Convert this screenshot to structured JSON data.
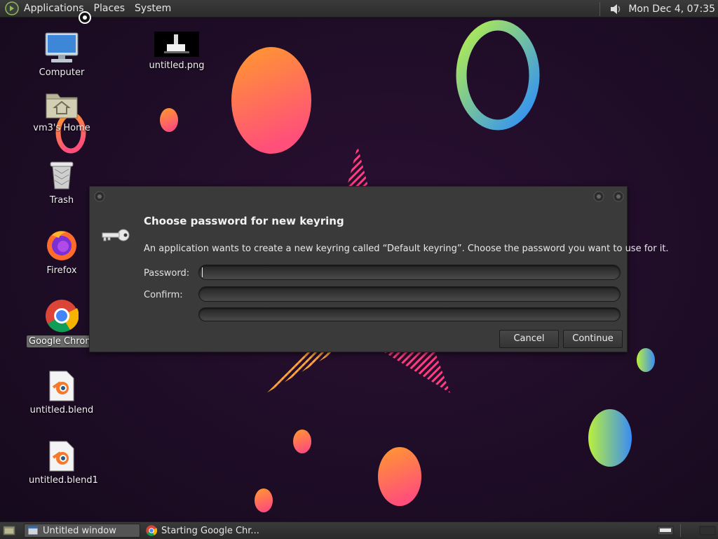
{
  "top_panel": {
    "menus": [
      "Applications",
      "Places",
      "System"
    ],
    "clock": "Mon Dec  4, 07:35"
  },
  "desktop": {
    "icons": [
      {
        "label": "Computer",
        "icon": "computer-icon"
      },
      {
        "label": "untitled.png",
        "icon": "image-thumbnail-icon"
      },
      {
        "label": "vm3's Home",
        "icon": "home-folder-icon"
      },
      {
        "label": "Trash",
        "icon": "trash-icon"
      },
      {
        "label": "Firefox",
        "icon": "firefox-icon"
      },
      {
        "label": "Google Chrome",
        "icon": "chrome-icon"
      },
      {
        "label": "untitled.blend",
        "icon": "blender-file-icon"
      },
      {
        "label": "untitled.blend1",
        "icon": "blender-file-icon"
      }
    ]
  },
  "dialog": {
    "title": "Choose password for new keyring",
    "message": "An application wants to create a new keyring called “Default keyring”. Choose the password you want to use for it.",
    "password_label": "Password:",
    "confirm_label": "Confirm:",
    "password_value": "",
    "confirm_value": "",
    "cancel_label": "Cancel",
    "continue_label": "Continue"
  },
  "bottom_panel": {
    "tasks": [
      {
        "label": "Untitled window",
        "active": true
      },
      {
        "label": "Starting Google Chr...",
        "active": false
      }
    ]
  },
  "colors": {
    "panel": "#2e2e2e",
    "dialog_bg": "#3a3a3a",
    "wallpaper_bg": "#1e0c26"
  }
}
